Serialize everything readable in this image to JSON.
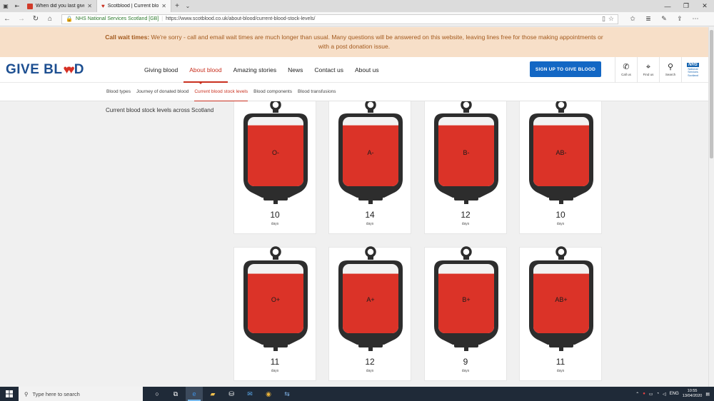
{
  "browser": {
    "tabs": [
      {
        "title": "When did you last give bloc",
        "favicon_color": "#d13b2a",
        "active": false
      },
      {
        "title": "Scotblood | Current blo",
        "favicon_color": "#c9301f",
        "active": true
      }
    ],
    "address_org": "NHS National Services Scotland [GB]",
    "url": "https://www.scotblood.co.uk/about-blood/current-blood-stock-levels/"
  },
  "banner": {
    "lead": "Call wait times:",
    "text": " We're sorry - call and email wait times are much longer than usual. Many questions will be answered on this website, leaving lines free for those making appointments or with a post donation issue."
  },
  "header": {
    "logo_left": "GIVE BL",
    "logo_hearts": "♥♥",
    "logo_right": "D",
    "nav": [
      {
        "label": "Giving blood",
        "active": false
      },
      {
        "label": "About blood",
        "active": true
      },
      {
        "label": "Amazing stories",
        "active": false
      },
      {
        "label": "News",
        "active": false
      },
      {
        "label": "Contact us",
        "active": false
      },
      {
        "label": "About us",
        "active": false
      }
    ],
    "signup_label": "SIGN UP TO GIVE BLOOD",
    "icons": [
      {
        "glyph": "✆",
        "label": "Call us"
      },
      {
        "glyph": "⌖",
        "label": "Find us"
      },
      {
        "glyph": "⚲",
        "label": "Search"
      }
    ],
    "nhs_badge": "NHS",
    "nhs_lines": [
      "National",
      "Services",
      "Scotland"
    ]
  },
  "subnav": [
    {
      "label": "Blood types",
      "active": false
    },
    {
      "label": "Journey of donated blood",
      "active": false
    },
    {
      "label": "Current blood stock levels",
      "active": true
    },
    {
      "label": "Blood components",
      "active": false
    },
    {
      "label": "Blood transfusions",
      "active": false
    }
  ],
  "content": {
    "title": "Current blood stock levels across Scotland",
    "unit_label": "days",
    "blood_red": "#db3328",
    "bag_dark": "#2d2d2d",
    "stocks": [
      {
        "type": "O-",
        "days": "10",
        "fill_level": 0.88
      },
      {
        "type": "A-",
        "days": "14",
        "fill_level": 0.88
      },
      {
        "type": "B-",
        "days": "12",
        "fill_level": 0.88
      },
      {
        "type": "AB-",
        "days": "10",
        "fill_level": 0.88
      },
      {
        "type": "O+",
        "days": "11",
        "fill_level": 0.86
      },
      {
        "type": "A+",
        "days": "12",
        "fill_level": 0.86
      },
      {
        "type": "B+",
        "days": "9",
        "fill_level": 0.86
      },
      {
        "type": "AB+",
        "days": "11",
        "fill_level": 0.86
      }
    ]
  },
  "taskbar": {
    "search_placeholder": "Type here to search",
    "language": "ENG",
    "time": "10:55",
    "date": "13/04/2020"
  }
}
